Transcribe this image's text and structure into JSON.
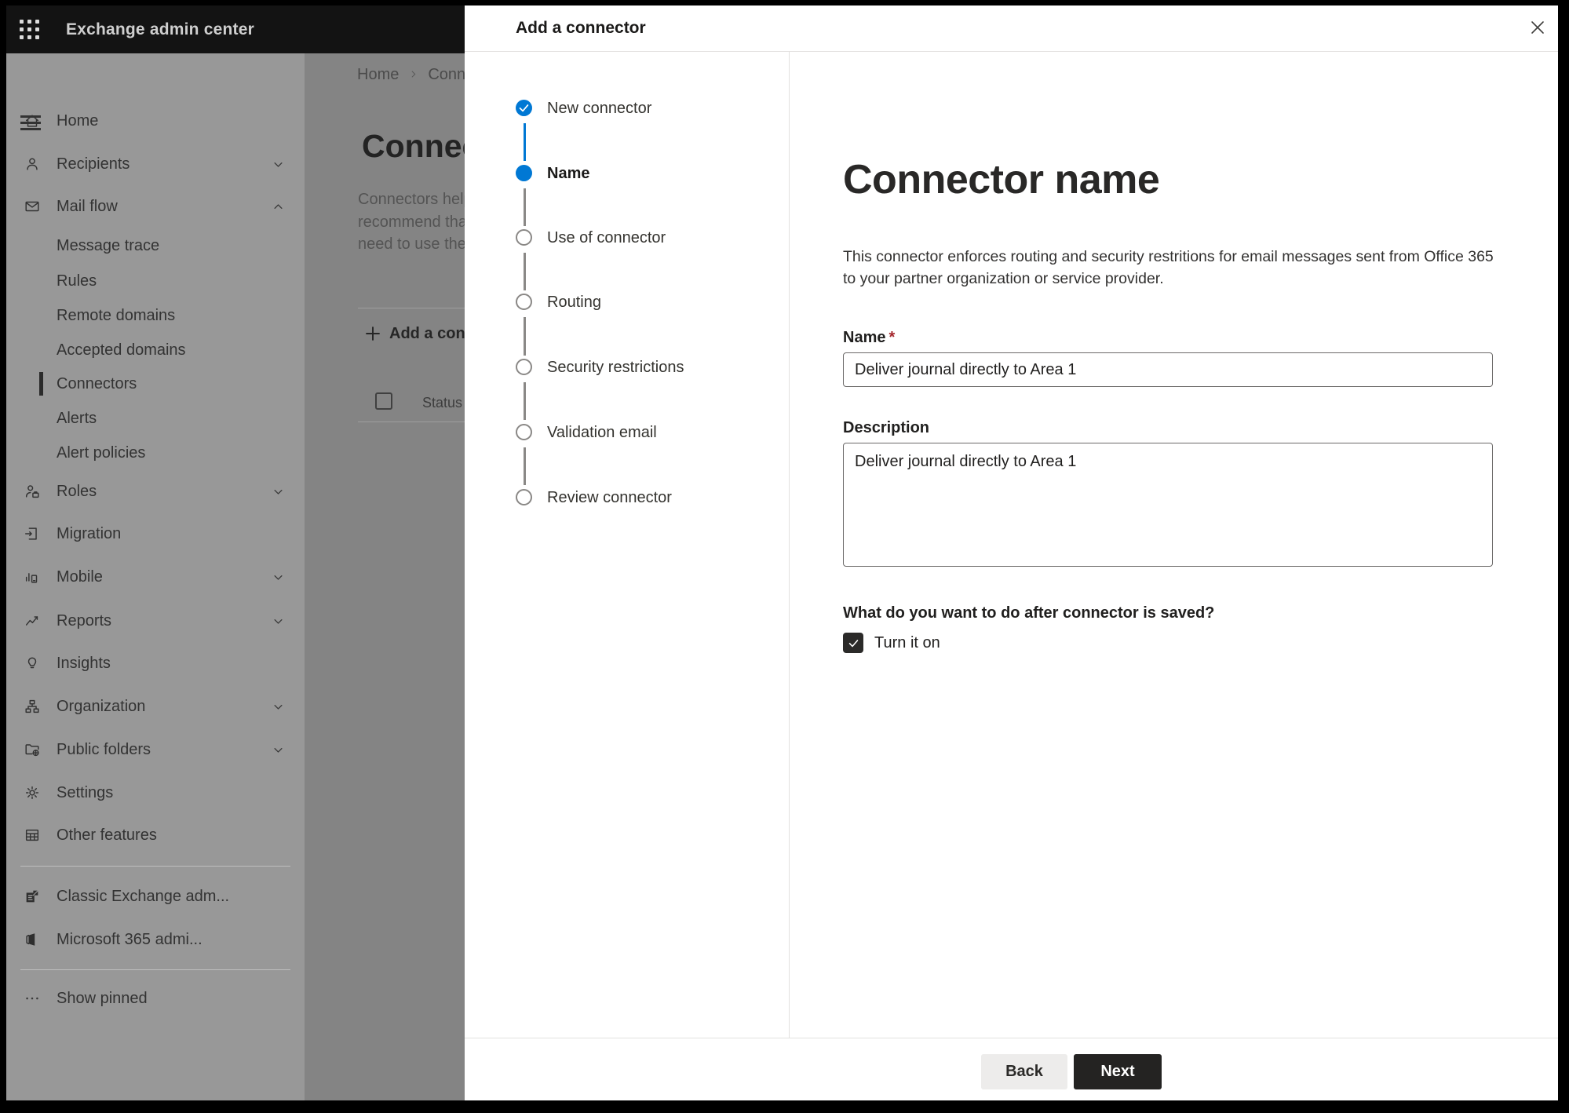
{
  "header": {
    "app_title": "Exchange admin center"
  },
  "sidebar": {
    "items": [
      {
        "label": "Home"
      },
      {
        "label": "Recipients"
      },
      {
        "label": "Mail flow"
      },
      {
        "label": "Message trace"
      },
      {
        "label": "Rules"
      },
      {
        "label": "Remote domains"
      },
      {
        "label": "Accepted domains"
      },
      {
        "label": "Connectors"
      },
      {
        "label": "Alerts"
      },
      {
        "label": "Alert policies"
      },
      {
        "label": "Roles"
      },
      {
        "label": "Migration"
      },
      {
        "label": "Mobile"
      },
      {
        "label": "Reports"
      },
      {
        "label": "Insights"
      },
      {
        "label": "Organization"
      },
      {
        "label": "Public folders"
      },
      {
        "label": "Settings"
      },
      {
        "label": "Other features"
      },
      {
        "label": "Classic Exchange adm..."
      },
      {
        "label": "Microsoft 365 admi..."
      },
      {
        "label": "Show pinned"
      }
    ]
  },
  "background": {
    "breadcrumb": {
      "home": "Home",
      "current": "Conne"
    },
    "page_title": "Connec",
    "intro_lines": {
      "line1": "Connectors help",
      "line2": "recommend tha",
      "line3": "need to use ther"
    },
    "add_connector_button": "Add a conn",
    "status_column": "Status"
  },
  "dialog": {
    "title": "Add a connector",
    "steps": [
      {
        "label": "New connector",
        "state": "completed"
      },
      {
        "label": "Name",
        "state": "current"
      },
      {
        "label": "Use of connector",
        "state": "upcoming"
      },
      {
        "label": "Routing",
        "state": "upcoming"
      },
      {
        "label": "Security restrictions",
        "state": "upcoming"
      },
      {
        "label": "Validation email",
        "state": "upcoming"
      },
      {
        "label": "Review connector",
        "state": "upcoming"
      }
    ],
    "content": {
      "heading": "Connector name",
      "description_line1": "This connector enforces routing and security restritions for email messages sent from Office 365",
      "description_line2": "to your partner organization or service provider.",
      "name_label": "Name",
      "required_mark": "*",
      "name_value": "Deliver journal directly to Area 1",
      "description_label": "Description",
      "description_value": "Deliver journal directly to Area 1",
      "after_save_question": "What do you want to do after connector is saved?",
      "turn_on_label": "Turn it on"
    },
    "footer": {
      "back_label": "Back",
      "next_label": "Next"
    }
  },
  "colors": {
    "accent": "#0078d4",
    "step_inactive": "#8a8886",
    "next_button_bg": "#242322",
    "back_button_bg": "#edeceb",
    "required_asterisk": "#a4262c",
    "checkbox_checked_bg": "#2b2a29"
  }
}
